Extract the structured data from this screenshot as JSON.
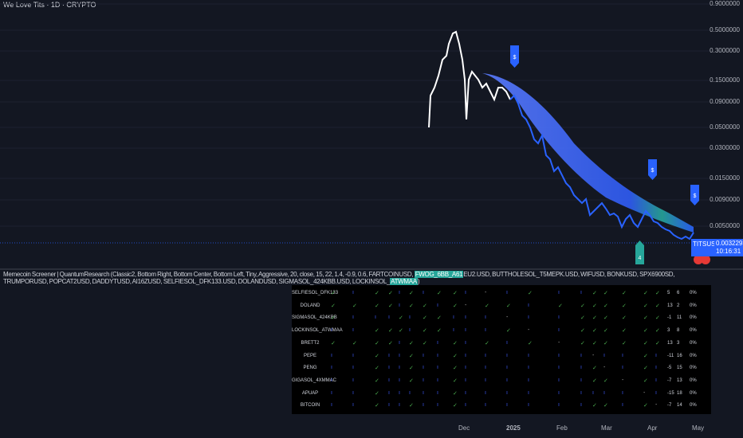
{
  "header": {
    "title": "We Love Tits · 1D · CRYPTO"
  },
  "y_axis": [
    "0.9000000",
    "0.5000000",
    "0.3000000",
    "0.1500000",
    "0.0900000",
    "0.0500000",
    "0.0300000",
    "0.0150000",
    "0.0090000",
    "0.0050000"
  ],
  "x_axis": [
    "Dec",
    "2025",
    "Feb",
    "Mar",
    "Apr",
    "May"
  ],
  "price": {
    "symbol": "TITSUSD",
    "value": "0.0032293",
    "countdown": "10:16:31"
  },
  "markers": {
    "flag": "$",
    "signal": "4"
  },
  "indicator": {
    "pre": "Memecoin Screener | QuantumResearch (Classic2, Bottom Right, Bottom Center, Bottom Left, Tiny, Aggressive, 20, close, 15, 22, 1.4, -0.9, 0.6, FARTCOINUSD, ",
    "hl1": "FWOG_6BB_A61",
    "mid": "EU2.USD, BUTTHOLESOL_T5MEPK.USD, WIFUSD, BONKUSD, SPX6900SD, TRUMPORUSD, POPCAT2USD, DADDYTUSD, AI16ZUSD, SELFIESOL_DFK133.USD, DOLANDUSD, SIGMASOL_424KBB.USD, LOCKINSOL_",
    "hl2": "ATWMAA",
    "post": ")"
  },
  "table": {
    "rows": [
      {
        "name": "SELFIESOL_DFK133",
        "cells": "cxccxcxccx-xcxxccccc",
        "a": "5",
        "b": "6",
        "pct": "0%"
      },
      {
        "name": "DOLAND",
        "cells": "ccccxccxc-ccxcccccc c",
        "a": "13",
        "b": "2",
        "pct": "0%"
      },
      {
        "name": "SIGMASOL_424KBB",
        "cells": "cxxxcxccxxx-xxcccccc",
        "a": "-1",
        "b": "11",
        "pct": "0%"
      },
      {
        "name": "LOCKINSOL_ATWMAA",
        "cells": "xxcccxccxxxc-xcccccc",
        "a": "3",
        "b": "8",
        "pct": "0%"
      },
      {
        "name": "BRETT2",
        "cells": "ccccxccxcxcxc-cccccc",
        "a": "13",
        "b": "3",
        "pct": "0%"
      },
      {
        "name": "PEPE",
        "cells": "xxcxxcxxcxxxxxx-xxcx",
        "a": "-11",
        "b": "16",
        "pct": "0%"
      },
      {
        "name": "PENG",
        "cells": "xxcxxcxxcxxxxxxc-xcx",
        "a": "-5",
        "b": "15",
        "pct": "0%"
      },
      {
        "name": "GIGASOL_4XMMAC",
        "cells": "xxcxxcxxcxxxxxxcc-cx",
        "a": "-7",
        "b": "13",
        "pct": "0%"
      },
      {
        "name": "APUAP",
        "cells": "xxcxxxxxcxxxxxxxxx-x",
        "a": "-15",
        "b": "18",
        "pct": "0%"
      },
      {
        "name": "BITCOIN",
        "cells": "xxcxxcxxcxxxxxxccxc-",
        "a": "-7",
        "b": "14",
        "pct": "0%"
      }
    ]
  },
  "colors": {
    "accent": "#2962ff",
    "teal": "#26a69a",
    "check": "#4caf50",
    "cross": "#3d5afe"
  }
}
